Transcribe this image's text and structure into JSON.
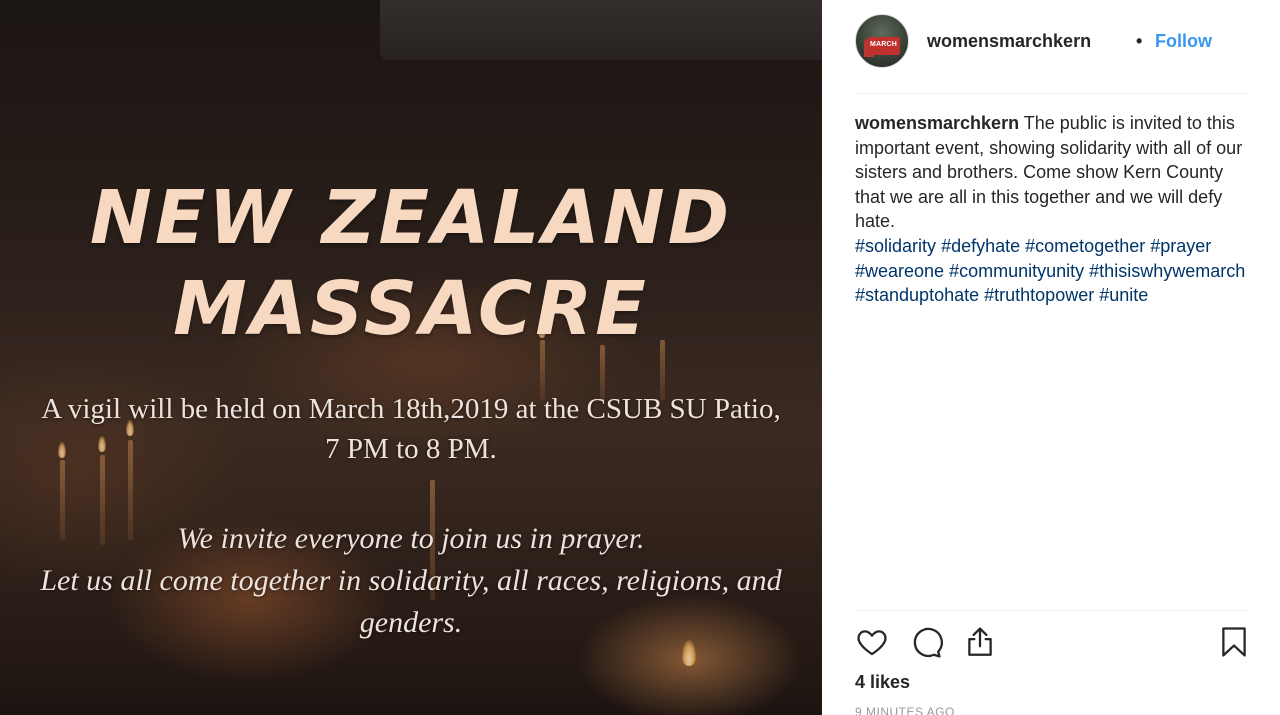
{
  "post_image": {
    "headline_line1": "NEW ZEALAND",
    "headline_line2": "MASSACRE",
    "vigil_line1": "A vigil will be held on March 18th,2019 at the  CSUB SU Patio,",
    "vigil_line2": "7 PM to 8 PM.",
    "invite_line1": "We invite everyone to join us in prayer.",
    "invite_line2": "Let us all come together in solidarity, all races, religions, and",
    "invite_line3": "genders."
  },
  "header": {
    "username": "womensmarchkern",
    "separator": "•",
    "follow_label": "Follow",
    "avatar_text": "MARCH"
  },
  "caption": {
    "username": "womensmarchkern",
    "text": "The public is invited to this important event, showing solidarity with all of our sisters and brothers. Come show Kern County that we are all in this together and we will defy hate.",
    "hashtags": [
      "#solidarity",
      "#defyhate",
      "#cometogether",
      "#prayer",
      "#weareone",
      "#communityunity",
      "#thisiswhywemarch",
      "#standuptohate",
      "#truthtopower",
      "#unite"
    ]
  },
  "actions": {
    "icons": [
      "heart-icon",
      "comment-icon",
      "share-icon",
      "bookmark-icon"
    ],
    "likes": "4 likes",
    "time_ago": "9 MINUTES AGO"
  },
  "colors": {
    "link_blue": "#3897f0",
    "hashtag": "#003569",
    "headline": "#f7d9c2"
  }
}
